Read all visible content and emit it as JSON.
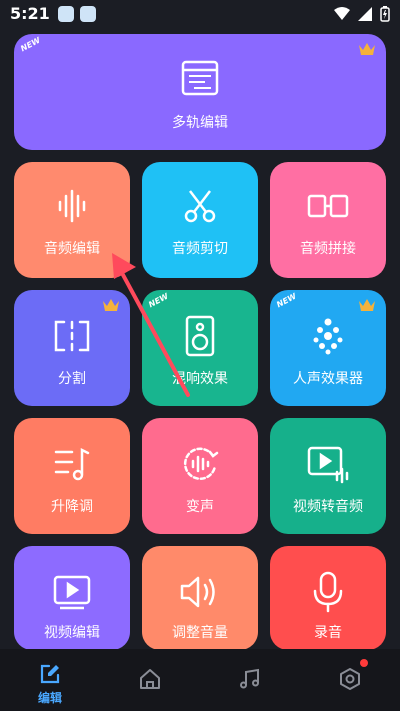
{
  "status_bar": {
    "time": "5:21"
  },
  "tiles": {
    "multitrack": {
      "label": "多轨编辑",
      "badge": "NEW",
      "color": "#8a69ff"
    },
    "audio_edit": {
      "label": "音频编辑",
      "color": "#ff8a6e"
    },
    "audio_cut": {
      "label": "音频剪切",
      "color": "#1fc1f5"
    },
    "audio_join": {
      "label": "音频拼接",
      "color": "#ff6fa3"
    },
    "split": {
      "label": "分割",
      "color": "#6c6cf6"
    },
    "reverb": {
      "label": "混响效果",
      "badge": "NEW",
      "color": "#18b58f"
    },
    "voice_fx": {
      "label": "人声效果器",
      "badge": "NEW",
      "color": "#21a8f2"
    },
    "pitch": {
      "label": "升降调",
      "color": "#ff7c63"
    },
    "voice_change": {
      "label": "变声",
      "color": "#ff6b8e"
    },
    "video_to_audio": {
      "label": "视频转音频",
      "color": "#16b08b"
    },
    "video_edit": {
      "label": "视频编辑",
      "color": "#8d6bff"
    },
    "volume": {
      "label": "调整音量",
      "color": "#ff8a6a"
    },
    "record": {
      "label": "录音",
      "color": "#ff4e4e"
    }
  },
  "nav": {
    "items": [
      {
        "id": "edit",
        "label": "编辑",
        "icon": "edit-icon",
        "active": true
      },
      {
        "id": "home",
        "label": "",
        "icon": "home-icon"
      },
      {
        "id": "music",
        "label": "",
        "icon": "music-note-icon"
      },
      {
        "id": "settings",
        "label": "",
        "icon": "settings-hex-icon",
        "badge_dot": true
      }
    ],
    "active_color": "#4aa8ff"
  }
}
